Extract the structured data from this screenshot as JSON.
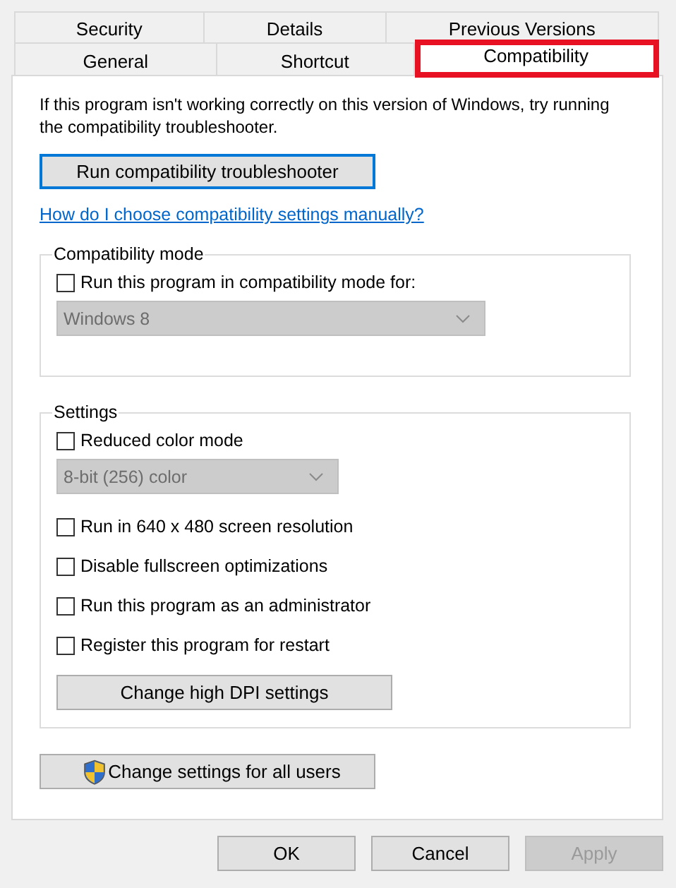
{
  "tabs_back": [
    {
      "label": "Security",
      "selected": false
    },
    {
      "label": "Details",
      "selected": false
    },
    {
      "label": "Previous Versions",
      "selected": false
    }
  ],
  "tabs_front": [
    {
      "label": "General",
      "selected": false,
      "highlighted": false
    },
    {
      "label": "Shortcut",
      "selected": false,
      "highlighted": false
    },
    {
      "label": "Compatibility",
      "selected": true,
      "highlighted": true
    }
  ],
  "intro": "If this program isn't working correctly on this version of Windows, try running the compatibility troubleshooter.",
  "troubleshooter_button": {
    "label": "Run compatibility troubleshooter",
    "focused": true
  },
  "help_link": "How do I choose compatibility settings manually?",
  "compatibility_mode": {
    "title": "Compatibility mode",
    "items": [
      {
        "kind": "checkbox",
        "label": "Run this program in compatibility mode for:",
        "checked": false
      },
      {
        "kind": "dropdown",
        "value": "Windows 8",
        "disabled": true
      }
    ]
  },
  "settings": {
    "title": "Settings",
    "items": [
      {
        "kind": "checkbox",
        "label": "Reduced color mode",
        "checked": false
      },
      {
        "kind": "dropdown",
        "value": "8-bit (256) color",
        "disabled": true
      },
      {
        "kind": "checkbox",
        "label": "Run in 640 x 480 screen resolution",
        "checked": false
      },
      {
        "kind": "checkbox",
        "label": "Disable fullscreen optimizations",
        "checked": false
      },
      {
        "kind": "checkbox",
        "label": "Run this program as an administrator",
        "checked": false
      },
      {
        "kind": "checkbox",
        "label": "Register this program for restart",
        "checked": false
      },
      {
        "kind": "button",
        "label": "Change high DPI settings"
      }
    ]
  },
  "all_users_button": {
    "label": "Change settings for all users"
  },
  "footer_buttons": [
    {
      "label": "OK",
      "disabled": false
    },
    {
      "label": "Cancel",
      "disabled": false
    },
    {
      "label": "Apply",
      "disabled": true
    }
  ]
}
